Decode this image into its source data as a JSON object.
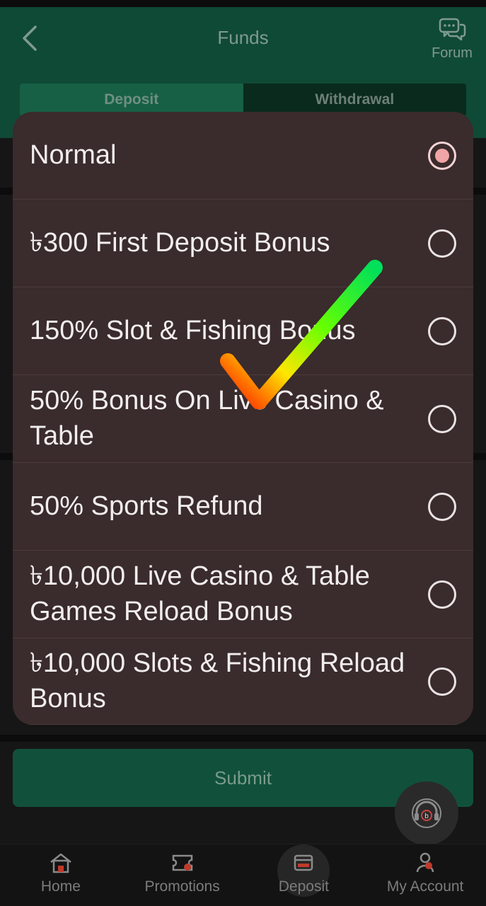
{
  "header": {
    "title": "Funds",
    "forum_label": "Forum",
    "tabs": [
      {
        "label": "Deposit",
        "active": true
      },
      {
        "label": "Withdrawal",
        "active": false
      }
    ]
  },
  "modal": {
    "options": [
      {
        "label": "Normal",
        "selected": true
      },
      {
        "label": "৳300 First Deposit Bonus",
        "selected": false
      },
      {
        "label": "150% Slot & Fishing Bonus",
        "selected": false
      },
      {
        "label": "50% Bonus On Live Casino & Table",
        "selected": false
      },
      {
        "label": "50% Sports Refund",
        "selected": false
      },
      {
        "label": "৳10,000 Live Casino & Table Games Reload Bonus",
        "selected": false
      },
      {
        "label": "৳10,000 Slots & Fishing Reload Bonus",
        "selected": false
      }
    ]
  },
  "submit_label": "Submit",
  "bottom_nav": {
    "items": [
      {
        "label": "Home",
        "icon": "home-icon",
        "active": false
      },
      {
        "label": "Promotions",
        "icon": "ticket-icon",
        "active": false
      },
      {
        "label": "Deposit",
        "icon": "wallet-icon",
        "active": true
      },
      {
        "label": "My Account",
        "icon": "user-icon",
        "active": false
      }
    ]
  },
  "colors": {
    "header_bg": "#0f4a36",
    "modal_bg": "#3a2b2c",
    "radio_selected": "#f0a4a6",
    "nav_accent": "#d93a3a"
  }
}
